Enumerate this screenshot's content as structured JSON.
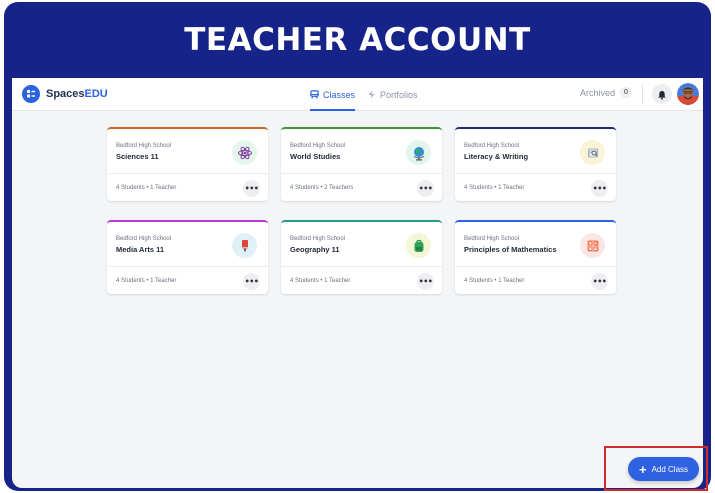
{
  "banner": {
    "title": "TEACHER ACCOUNT"
  },
  "brand": {
    "name_part1": "Spaces",
    "name_part2": "EDU"
  },
  "nav": {
    "tabs": [
      {
        "label": "Classes",
        "active": true,
        "icon": "classes-icon"
      },
      {
        "label": "Portfolios",
        "active": false,
        "icon": "portfolios-icon"
      }
    ]
  },
  "archived": {
    "label": "Archived",
    "count": "0"
  },
  "cards": [
    {
      "school": "Bedford High School",
      "name": "Sciences 11",
      "meta": "4 Students • 1 Teacher",
      "accent": "#c96a2a",
      "icon": "atom-icon",
      "icon_bg": "#e7f6ea"
    },
    {
      "school": "Bedford High School",
      "name": "World Studies",
      "meta": "4 Students • 2 Teachers",
      "accent": "#3a9a3a",
      "icon": "globe-icon",
      "icon_bg": "#e2f4ee"
    },
    {
      "school": "Bedford High School",
      "name": "Literacy & Writing",
      "meta": "4 Students • 1 Teacher",
      "accent": "#1f2a7a",
      "icon": "book-icon",
      "icon_bg": "#fbf3d6"
    },
    {
      "school": "Bedford High School",
      "name": "Media Arts 11",
      "meta": "4 Students • 1 Teacher",
      "accent": "#b63bd1",
      "icon": "brush-icon",
      "icon_bg": "#dff1f7"
    },
    {
      "school": "Bedford High School",
      "name": "Geography 11",
      "meta": "4 Students • 1 Teacher",
      "accent": "#2a9a8e",
      "icon": "backpack-icon",
      "icon_bg": "#f6f5d8"
    },
    {
      "school": "Bedford High School",
      "name": "Principles of Mathematics",
      "meta": "4 Students • 1 Teacher",
      "accent": "#2f62e0",
      "icon": "calculator-icon",
      "icon_bg": "#fbe6e6"
    }
  ],
  "fab": {
    "label": "Add Class"
  }
}
